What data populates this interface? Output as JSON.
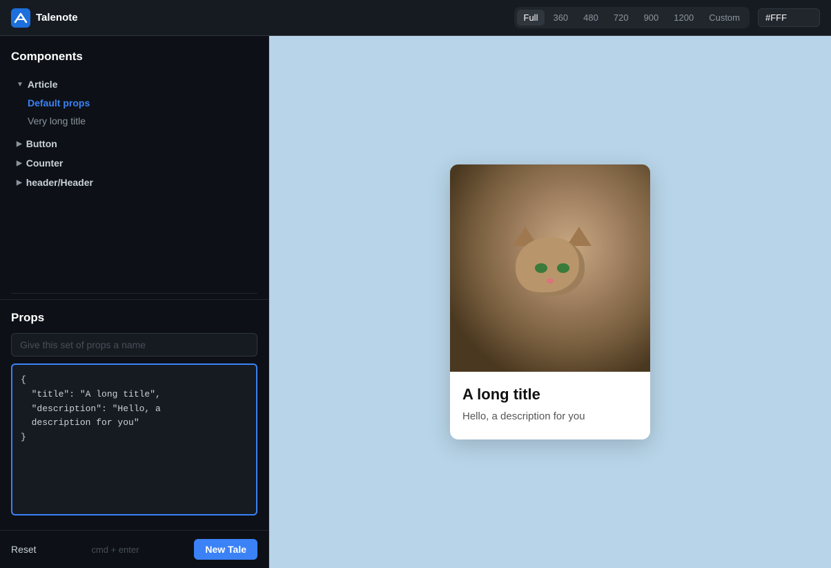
{
  "header": {
    "logo_text": "Talenote",
    "viewport_buttons": [
      "Full",
      "360",
      "480",
      "720",
      "900",
      "1200",
      "Custom"
    ],
    "active_viewport": "Full",
    "color_value": "#FFF"
  },
  "sidebar": {
    "components_title": "Components",
    "tree": [
      {
        "label": "Article",
        "expanded": true,
        "children": [
          {
            "label": "Default props",
            "active": true
          },
          {
            "label": "Very long title",
            "active": false
          }
        ]
      },
      {
        "label": "Button",
        "expanded": false
      },
      {
        "label": "Counter",
        "expanded": false
      },
      {
        "label": "header/Header",
        "expanded": false
      }
    ]
  },
  "props": {
    "section_title": "Props",
    "name_placeholder": "Give this set of props a name",
    "editor_content": "{\n  \"title\": \"A long title\",\n  \"description\": \"Hello, a\n  description for you\"\n}"
  },
  "footer": {
    "reset_label": "Reset",
    "shortcut_hint": "cmd + enter",
    "new_tale_label": "New Tale"
  },
  "preview": {
    "card": {
      "title": "A long title",
      "description": "Hello, a description for you"
    }
  }
}
